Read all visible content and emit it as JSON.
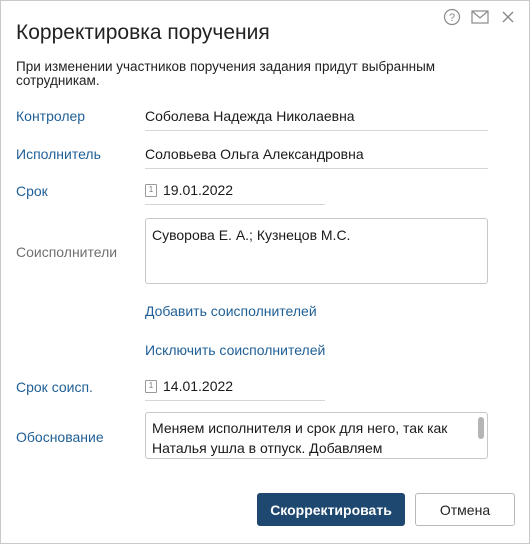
{
  "dialog": {
    "title": "Корректировка поручения",
    "notice": "При изменении участников поручения задания придут выбранным сотрудникам.",
    "icons": {
      "help": "help-icon",
      "mail": "mail-icon",
      "close": "close-icon"
    }
  },
  "fields": {
    "controller": {
      "label": "Контролер",
      "value": "Соболева Надежда Николаевна"
    },
    "executor": {
      "label": "Исполнитель",
      "value": "Соловьева Ольга Александровна"
    },
    "deadline": {
      "label": "Срок",
      "value": "19.01.2022",
      "calendar_day": "1"
    },
    "coexecutors": {
      "label": "Соисполнители",
      "value": "Суворова Е. А.; Кузнецов М.С."
    },
    "add_coexecutors_link": "Добавить соисполнителей",
    "exclude_coexecutors_link": "Исключить соисполнителей",
    "coexec_deadline": {
      "label": "Срок соисп.",
      "value": "14.01.2022",
      "calendar_day": "1"
    },
    "reason": {
      "label": "Обоснование",
      "value": "Меняем исполнителя и срок для него, так как Наталья ушла в отпуск. Добавляем соисполнителя, так как"
    }
  },
  "buttons": {
    "submit": "Скорректировать",
    "cancel": "Отмена"
  },
  "colors": {
    "accent": "#1f5f96",
    "primary_button": "#1e4870"
  }
}
